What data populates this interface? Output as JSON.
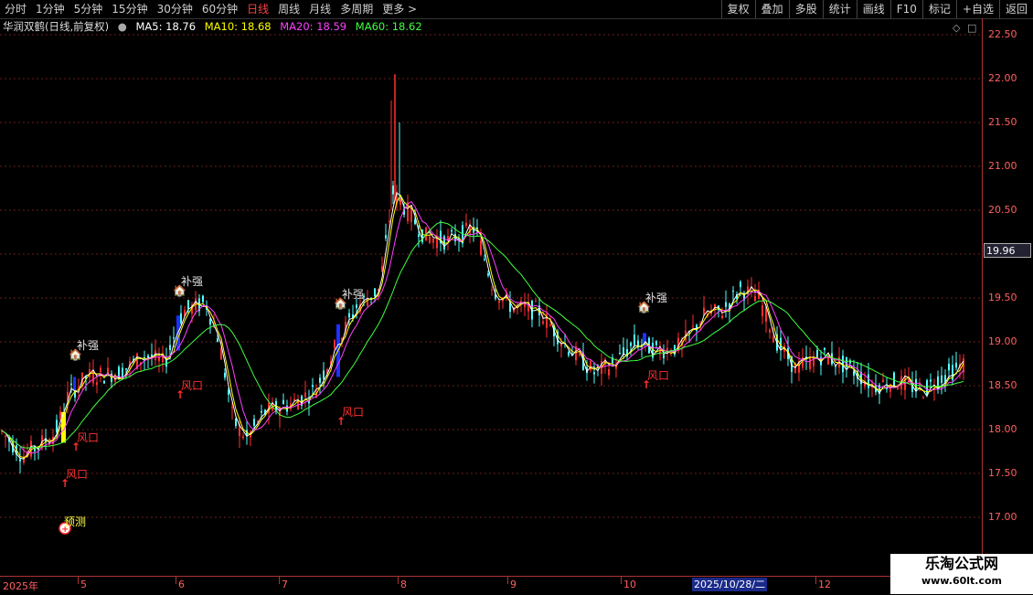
{
  "toolbar": {
    "timeframes": [
      "分时",
      "1分钟",
      "5分钟",
      "15分钟",
      "30分钟",
      "60分钟",
      "日线",
      "周线",
      "月线",
      "多周期",
      "更多 >"
    ],
    "active_index": 6,
    "right_tools": [
      "复权",
      "叠加",
      "多股",
      "统计",
      "画线",
      "F10",
      "标记",
      "+自选",
      "返回"
    ]
  },
  "info": {
    "stock": "华润双鹤(日线,前复权)",
    "ma5": "MA5: 18.76",
    "ma10": "MA10: 18.68",
    "ma20": "MA20: 18.59",
    "ma60": "MA60: 18.62",
    "colors": {
      "ma5": "#ffffff",
      "ma10": "#ffff00",
      "ma20": "#ff40ff",
      "ma60": "#40ff40",
      "up": "#ff3030",
      "down": "#54ffff"
    }
  },
  "axis": {
    "ticks": [
      "22.50",
      "22.00",
      "21.50",
      "21.00",
      "20.50",
      "20.00",
      "19.50",
      "19.00",
      "18.50",
      "18.00",
      "17.50",
      "17.00"
    ],
    "current_price": "19.96"
  },
  "dates": {
    "labels": [
      "2025年",
      "5",
      "6",
      "7",
      "8",
      "9",
      "10",
      "12"
    ],
    "selected": "2025/10/28/二"
  },
  "signals": {
    "bq": "补强",
    "fk": "风口",
    "yc": "预测"
  },
  "watermark": {
    "line1": "乐淘公式网",
    "line2": "www.60lt.com"
  }
}
